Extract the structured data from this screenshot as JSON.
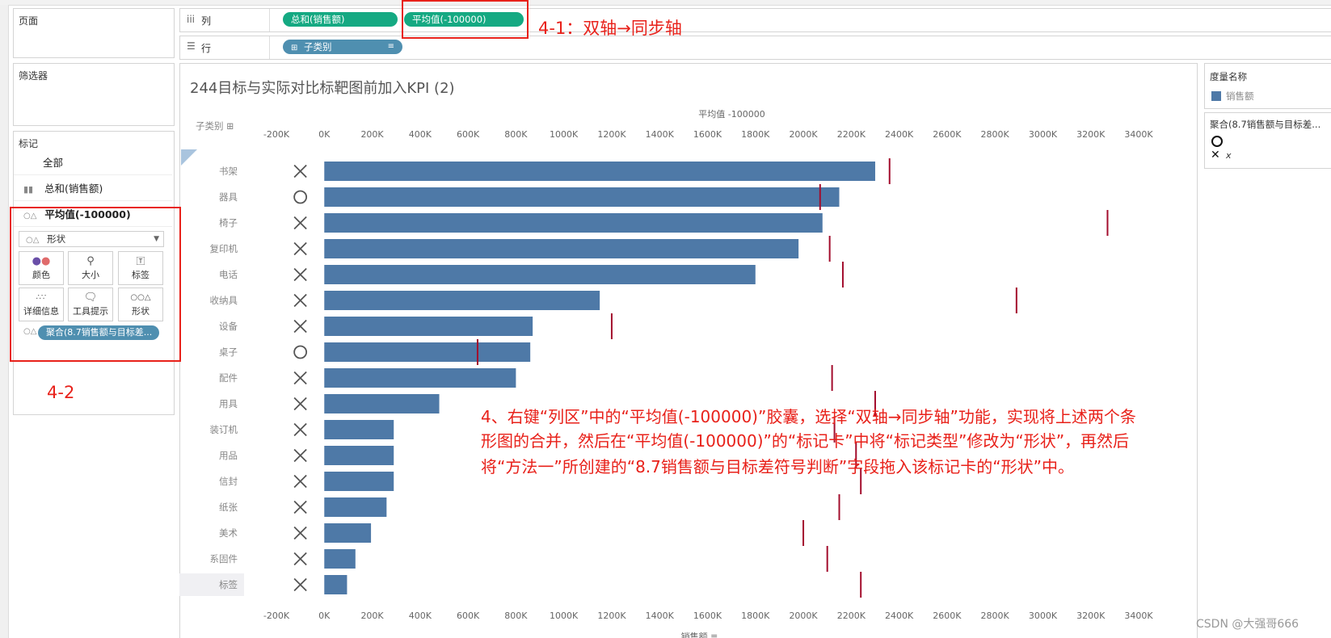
{
  "left": {
    "pages_title": "页面",
    "filters_title": "筛选器",
    "marks_title": "标记",
    "marks_items": [
      "全部",
      "总和(销售额)",
      "平均值(-100000)"
    ],
    "mark_type": "形状",
    "buttons": [
      "颜色",
      "大小",
      "标签",
      "详细信息",
      "工具提示",
      "形状"
    ],
    "shape_pill": "聚合(8.7销售额与目标差..."
  },
  "shelves": {
    "columns_label": "列",
    "rows_label": "行",
    "col_pills": [
      "总和(销售额)",
      "平均值(-100000)"
    ],
    "row_pill": "子类别"
  },
  "sheet": {
    "title": "244目标与实际对比标靶图前加入KPI (2)",
    "category_header": "子类别"
  },
  "legend": {
    "measure_title": "度量名称",
    "measure_item": "销售额",
    "shape_title": "聚合(8.7销售额与目标差...",
    "shape_items": [
      "",
      "x"
    ]
  },
  "annotations": {
    "a41": "4-1：双轴→同步轴",
    "a42": "4-2",
    "main": [
      "4、右键“列区”中的“平均值(-100000)”胶囊，选择“双轴→同步轴”功能，实现将上述两个条",
      "形图的合并，然后在“平均值(-100000)”的“标记卡”中将“标记类型”修改为“形状”，再然后",
      "将“方法一”所创建的“8.7销售额与目标差符号判断”字段拖入该标记卡的“形状”中。"
    ]
  },
  "watermark": "CSDN @大强哥666",
  "chart_data": {
    "type": "bar",
    "top_axis_title": "平均值 -100000",
    "bottom_axis_title": "销售额",
    "ticks": [
      "-200K",
      "0K",
      "200K",
      "400K",
      "600K",
      "800K",
      "1000K",
      "1200K",
      "1400K",
      "1600K",
      "1800K",
      "2000K",
      "2200K",
      "2400K",
      "2600K",
      "2800K",
      "3000K",
      "3200K",
      "3400K"
    ],
    "xlim": [
      -200000,
      3400000
    ],
    "categories": [
      "书架",
      "器具",
      "椅子",
      "复印机",
      "电话",
      "收纳具",
      "设备",
      "桌子",
      "配件",
      "用具",
      "装订机",
      "用品",
      "信封",
      "纸张",
      "美术",
      "系固件",
      "标签"
    ],
    "series": [
      {
        "values": [
          2300000,
          2150000,
          2080000,
          1980000,
          1800000,
          1150000,
          870000,
          860000,
          800000,
          480000,
          290000,
          290000,
          290000,
          260000,
          195000,
          130000,
          95000
        ]
      },
      {
        "values": [
          2360000,
          2070000,
          3270000,
          2110000,
          2165000,
          2890000,
          1200000,
          640000,
          2120000,
          2300000,
          2130000,
          2220000,
          2240000,
          2150000,
          2000000,
          2100000,
          2240000
        ]
      }
    ],
    "marker_shapes": [
      "x",
      "o",
      "x",
      "x",
      "x",
      "x",
      "x",
      "o",
      "x",
      "x",
      "x",
      "x",
      "x",
      "x",
      "x",
      "x",
      "x"
    ],
    "colors": {
      "bar": "#4e79a7",
      "target": "#a30d2d",
      "marker": "#555555"
    }
  }
}
